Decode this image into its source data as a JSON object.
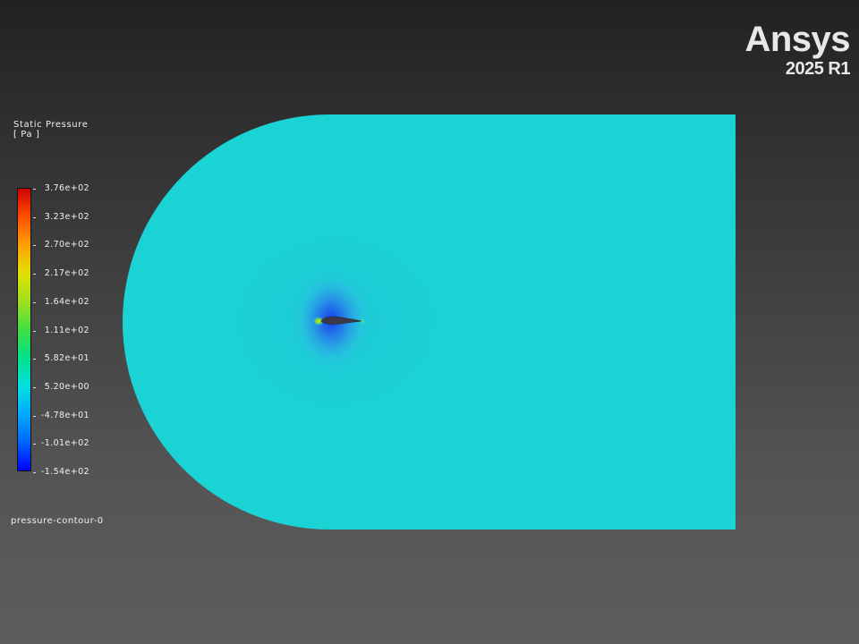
{
  "brand": {
    "name": "Ansys",
    "version": "2025 R1"
  },
  "legend": {
    "title": "Static Pressure",
    "unit": "[ Pa ]",
    "colormap": [
      "#0000ff",
      "#0066ff",
      "#00aaff",
      "#00e0e0",
      "#00e08a",
      "#40e040",
      "#a0e020",
      "#e0e000",
      "#ffa000",
      "#ff5000",
      "#d00000"
    ],
    "ticks": [
      "3.76e+02",
      "3.23e+02",
      "2.70e+02",
      "2.17e+02",
      "1.64e+02",
      "1.11e+02",
      "5.82e+01",
      "5.20e+00",
      "-4.78e+01",
      "-1.01e+02",
      "-1.54e+02"
    ]
  },
  "contour_name": "pressure-contour-0",
  "field_color": "#1bd2d4"
}
